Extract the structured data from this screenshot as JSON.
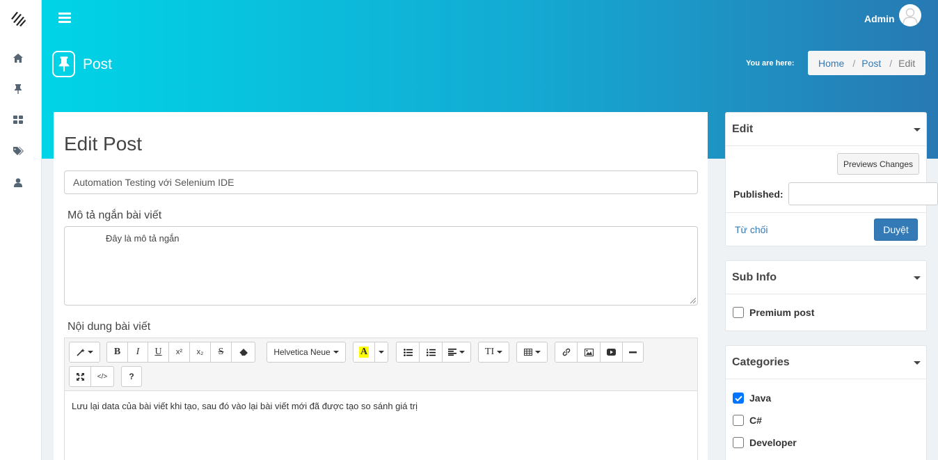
{
  "header": {
    "user_name": "Admin",
    "page_title": "Post",
    "you_are_here": "You are here:",
    "breadcrumb": [
      {
        "label": "Home"
      },
      {
        "label": "Post"
      },
      {
        "label": "Edit"
      }
    ]
  },
  "sidebar": {
    "items": [
      {
        "icon": "home-icon"
      },
      {
        "icon": "pin-icon"
      },
      {
        "icon": "dashboard-icon"
      },
      {
        "icon": "tags-icon"
      },
      {
        "icon": "user-icon"
      }
    ]
  },
  "main": {
    "heading": "Edit Post",
    "title_value": "Automation Testing với Selenium IDE",
    "desc_label": "Mô tả ngắn bài viết",
    "desc_value": "Đây là mô tả ngắn",
    "content_label": "Nội dung bài viết",
    "content_value": "Lưu lại data của bài viết khi tạo, sau đó vào lại bài viết mới đã được tạo so sánh giá trị",
    "toolbar": {
      "font_name": "Helvetica Neue",
      "bold": "B",
      "italic": "I",
      "underline": "U",
      "superscript": "x²",
      "subscript": "x₂",
      "strike": "S",
      "color_letter": "A",
      "font_size": "TI",
      "code": "</>",
      "help": "?"
    }
  },
  "edit_panel": {
    "title": "Edit",
    "preview_label": "Previews Changes",
    "published_label": "Published:",
    "reject_label": "Từ chối",
    "approve_label": "Duyệt"
  },
  "subinfo_panel": {
    "title": "Sub Info",
    "premium_label": "Premium post",
    "premium_checked": false
  },
  "categories_panel": {
    "title": "Categories",
    "items": [
      {
        "label": "Java",
        "checked": true
      },
      {
        "label": "C#",
        "checked": false
      },
      {
        "label": "Developer",
        "checked": false
      }
    ]
  },
  "colors": {
    "gradient_start": "#00d4e6",
    "gradient_end": "#2879b3",
    "primary": "#337ab7",
    "checkbox_checked": "#0075ff"
  }
}
